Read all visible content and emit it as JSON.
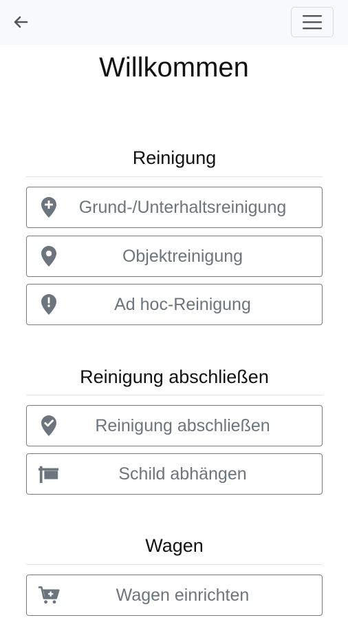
{
  "header": {
    "back_icon": "arrow-left-icon",
    "menu_icon": "hamburger-menu-icon"
  },
  "page": {
    "title": "Willkommen"
  },
  "sections": [
    {
      "title": "Reinigung",
      "buttons": [
        {
          "label": "Grund-/Unterhaltsreinigung",
          "icon": "map-marker-plus-icon"
        },
        {
          "label": "Objektreinigung",
          "icon": "map-marker-icon"
        },
        {
          "label": "Ad hoc-Reinigung",
          "icon": "map-marker-exclamation-icon"
        }
      ]
    },
    {
      "title": "Reinigung abschließen",
      "buttons": [
        {
          "label": "Reinigung abschließen",
          "icon": "map-marker-check-icon"
        },
        {
          "label": "Schild abhängen",
          "icon": "sign-icon"
        }
      ]
    },
    {
      "title": "Wagen",
      "buttons": [
        {
          "label": "Wagen einrichten",
          "icon": "cart-plus-icon"
        }
      ]
    }
  ],
  "colors": {
    "topbar_bg": "#f8f9fa",
    "icon": "#6c757d",
    "button_text": "#6c757d",
    "button_border": "#777c81"
  }
}
